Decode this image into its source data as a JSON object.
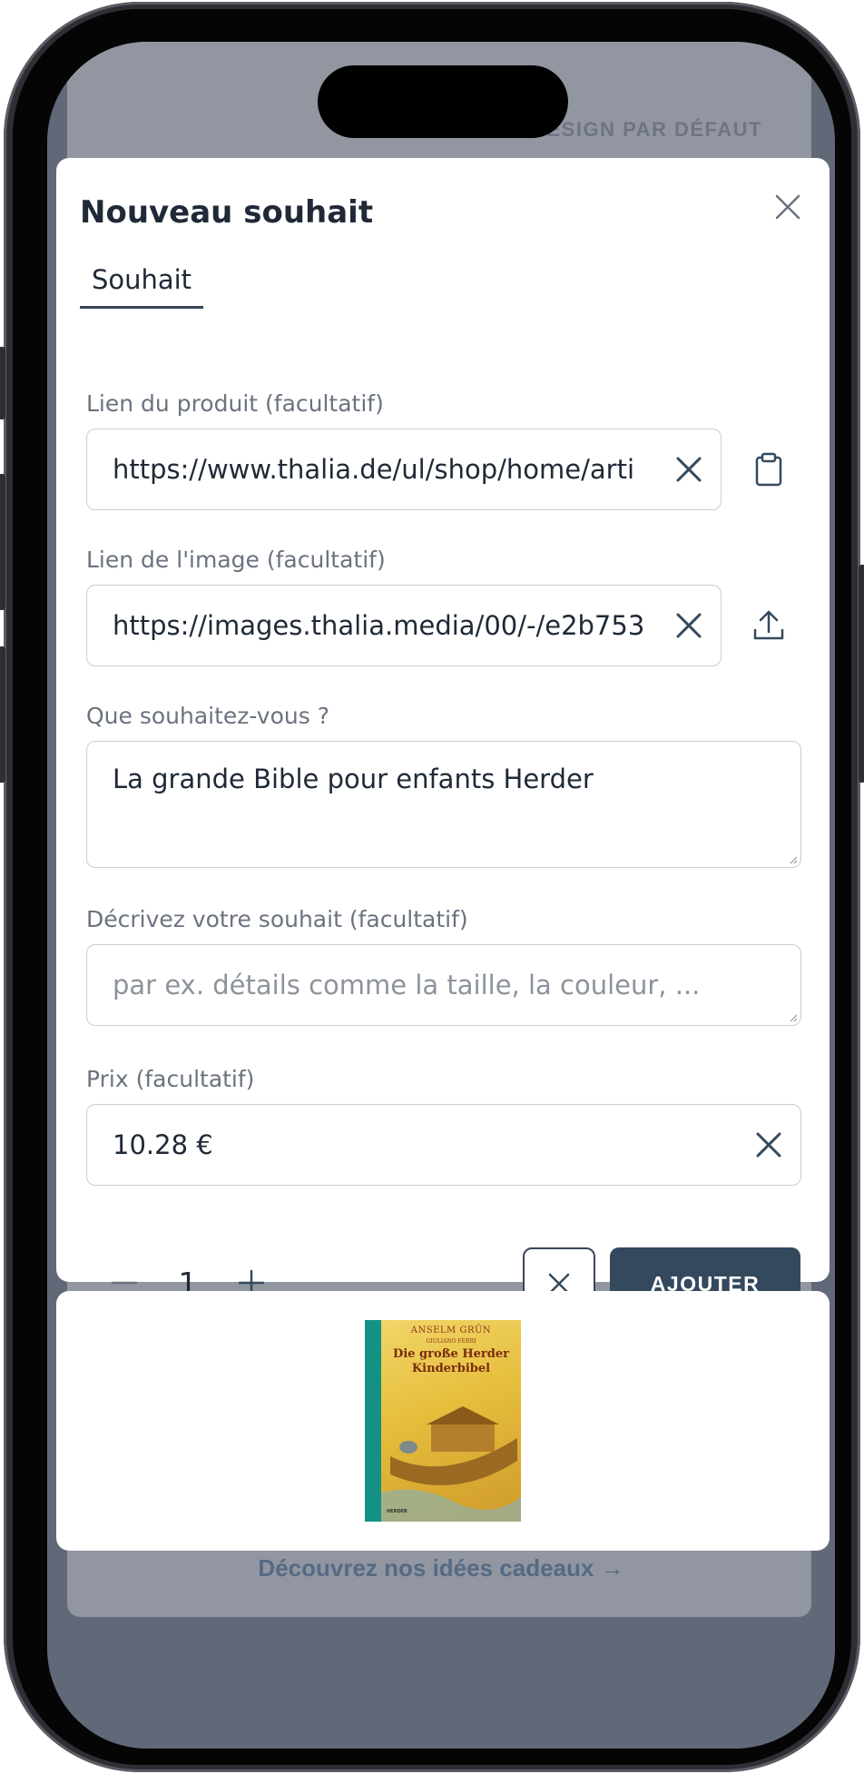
{
  "background": {
    "default_label": "DESIGN PAR DÉFAUT",
    "gift_ideas_link": "Découvrez nos idées cadeaux →"
  },
  "modal": {
    "title": "Nouveau souhait",
    "tab_label": "Souhait",
    "product_link": {
      "label": "Lien du produit (facultatif)",
      "value": "https://www.thalia.de/ul/shop/home/arti"
    },
    "image_link": {
      "label": "Lien de l'image (facultatif)",
      "value": "https://images.thalia.media/00/-/e2b753"
    },
    "wish": {
      "label": "Que souhaitez-vous ?",
      "value": "La grande Bible pour enfants Herder"
    },
    "description": {
      "label": "Décrivez votre souhait (facultatif)",
      "placeholder": "par ex. détails comme la taille, la couleur, ..."
    },
    "price": {
      "label": "Prix (facultatif)",
      "value": "10.28 €"
    },
    "quantity": "1",
    "add_button": "AJOUTER"
  },
  "preview": {
    "book_author": "ANSELM GRÜN",
    "book_coauthor": "GIULIANO FERRI",
    "book_title": "Die große Herder Kinderbibel",
    "book_publisher": "HERDER"
  }
}
